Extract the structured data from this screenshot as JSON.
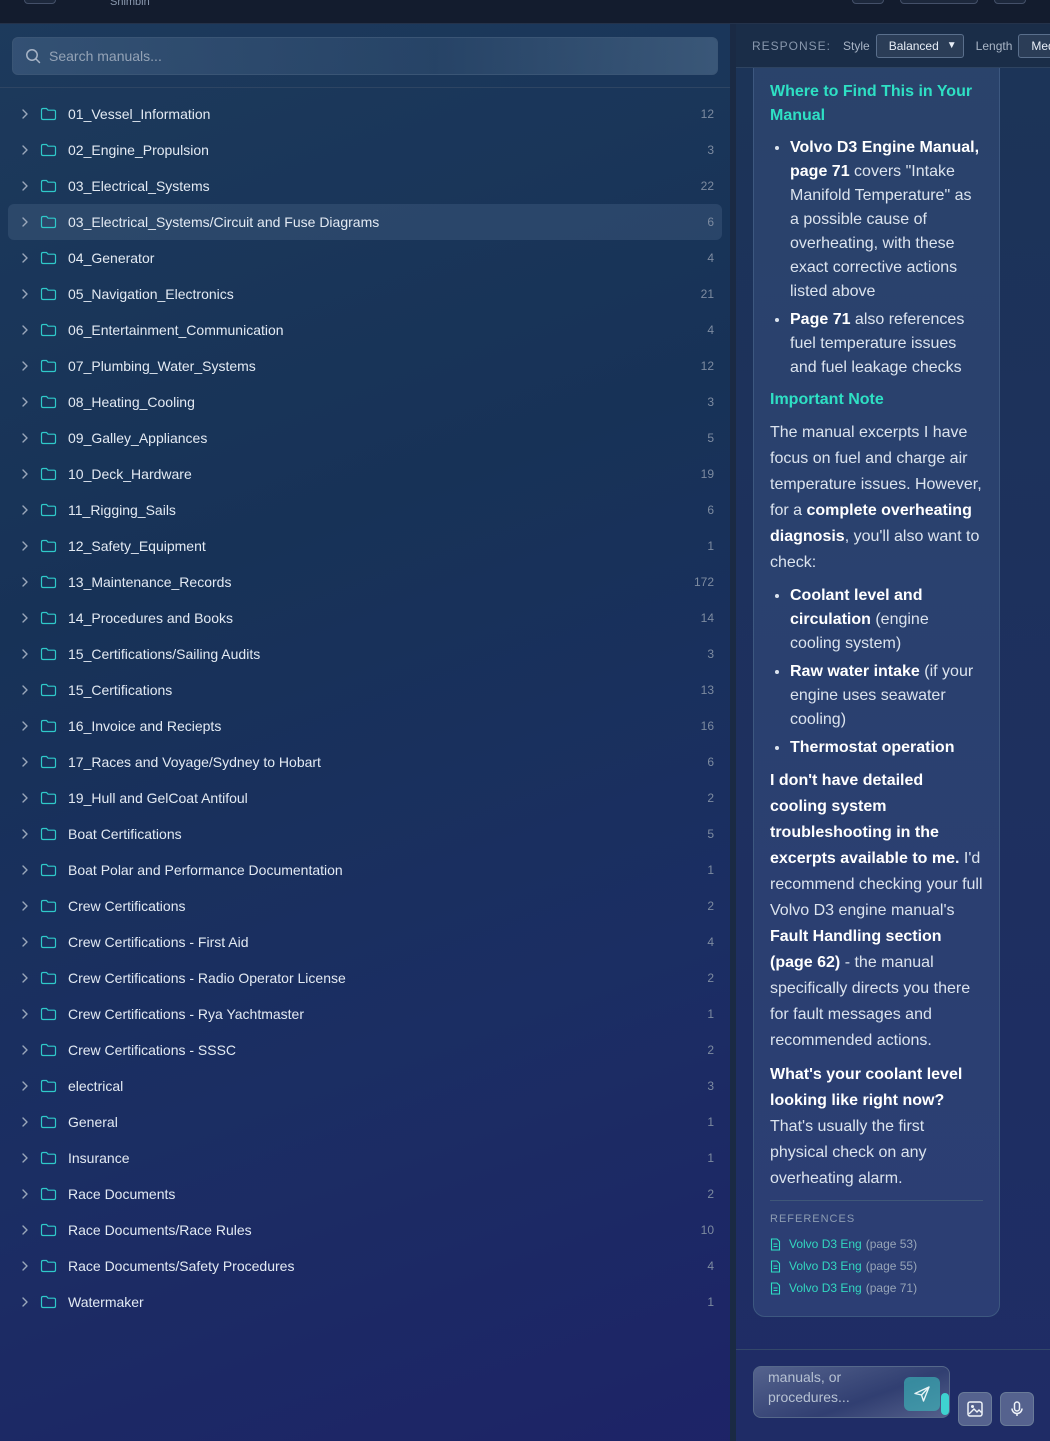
{
  "app": {
    "subtitle": "Shimbin"
  },
  "search": {
    "placeholder": "Search manuals..."
  },
  "folders": [
    {
      "name": "01_Vessel_Information",
      "count": "12"
    },
    {
      "name": "02_Engine_Propulsion",
      "count": "3"
    },
    {
      "name": "03_Electrical_Systems",
      "count": "22"
    },
    {
      "name": "03_Electrical_Systems/Circuit and Fuse Diagrams",
      "count": "6"
    },
    {
      "name": "04_Generator",
      "count": "4"
    },
    {
      "name": "05_Navigation_Electronics",
      "count": "21"
    },
    {
      "name": "06_Entertainment_Communication",
      "count": "4"
    },
    {
      "name": "07_Plumbing_Water_Systems",
      "count": "12"
    },
    {
      "name": "08_Heating_Cooling",
      "count": "3"
    },
    {
      "name": "09_Galley_Appliances",
      "count": "5"
    },
    {
      "name": "10_Deck_Hardware",
      "count": "19"
    },
    {
      "name": "11_Rigging_Sails",
      "count": "6"
    },
    {
      "name": "12_Safety_Equipment",
      "count": "1"
    },
    {
      "name": "13_Maintenance_Records",
      "count": "172"
    },
    {
      "name": "14_Procedures and Books",
      "count": "14"
    },
    {
      "name": "15_Certifications/Sailing Audits",
      "count": "3"
    },
    {
      "name": "15_Certifications",
      "count": "13"
    },
    {
      "name": "16_Invoice and Reciepts",
      "count": "16"
    },
    {
      "name": "17_Races and Voyage/Sydney to Hobart",
      "count": "6"
    },
    {
      "name": "19_Hull and GelCoat Antifoul",
      "count": "2"
    },
    {
      "name": "Boat Certifications",
      "count": "5"
    },
    {
      "name": "Boat Polar and Performance Documentation",
      "count": "1"
    },
    {
      "name": "Crew Certifications",
      "count": "2"
    },
    {
      "name": "Crew Certifications - First Aid",
      "count": "4"
    },
    {
      "name": "Crew Certifications - Radio Operator License",
      "count": "2"
    },
    {
      "name": "Crew Certifications - Rya Yachtmaster",
      "count": "1"
    },
    {
      "name": "Crew Certifications - SSSC",
      "count": "2"
    },
    {
      "name": "electrical",
      "count": "3"
    },
    {
      "name": "General",
      "count": "1"
    },
    {
      "name": "Insurance",
      "count": "1"
    },
    {
      "name": "Race Documents",
      "count": "2"
    },
    {
      "name": "Race Documents/Race Rules",
      "count": "10"
    },
    {
      "name": "Race Documents/Safety Procedures",
      "count": "4"
    },
    {
      "name": "Watermaker",
      "count": "1"
    }
  ],
  "active_folder_index": 3,
  "response_bar": {
    "label": "RESPONSE:",
    "style_label": "Style",
    "style_value": "Balanced",
    "length_label": "Length",
    "length_value": "Med"
  },
  "answer": {
    "h_where": "Where to Find This in Your Manual",
    "where_1_bold": "Volvo D3 Engine Manual, page 71",
    "where_1_rest": " covers \"Intake Manifold Temperature\" as a possible cause of overheating, with these exact corrective actions listed above",
    "where_2_bold": "Page 71",
    "where_2_rest": " also references fuel temperature issues and fuel leakage checks",
    "h_note": "Important Note",
    "note_p_1": "The manual excerpts I have focus on fuel and charge air temperature issues. However, for a ",
    "note_p_bold": "complete overheating diagnosis",
    "note_p_2": ", you'll also want to check:",
    "check_1_bold": "Coolant level and circulation",
    "check_1_rest": " (engine cooling system)",
    "check_2_bold": "Raw water intake",
    "check_2_rest": " (if your engine uses seawater cooling)",
    "check_3_bold": "Thermostat operation",
    "p2_bold_1": "I don't have detailed cooling system troubleshooting in the excerpts available to me.",
    "p2_text_1": " I'd recommend checking your full Volvo D3 engine manual's ",
    "p2_bold_2": "Fault Handling section (page 62)",
    "p2_text_2": " - the manual specifically directs you there for fault messages and recommended actions.",
    "q_bold": "What's your coolant level looking like right now?",
    "q_rest": " That's usually the first physical check on any overheating alarm."
  },
  "references": {
    "title": "REFERENCES",
    "items": [
      {
        "name": "Volvo D3 Eng",
        "page": "(page 53)"
      },
      {
        "name": "Volvo D3 Eng",
        "page": "(page 55)"
      },
      {
        "name": "Volvo D3 Eng",
        "page": "(page 71)"
      }
    ]
  },
  "composer": {
    "placeholder": "manuals, or procedures..."
  },
  "colors": {
    "accent": "#2ee0c4",
    "folder_icon": "#2fc9c9"
  }
}
